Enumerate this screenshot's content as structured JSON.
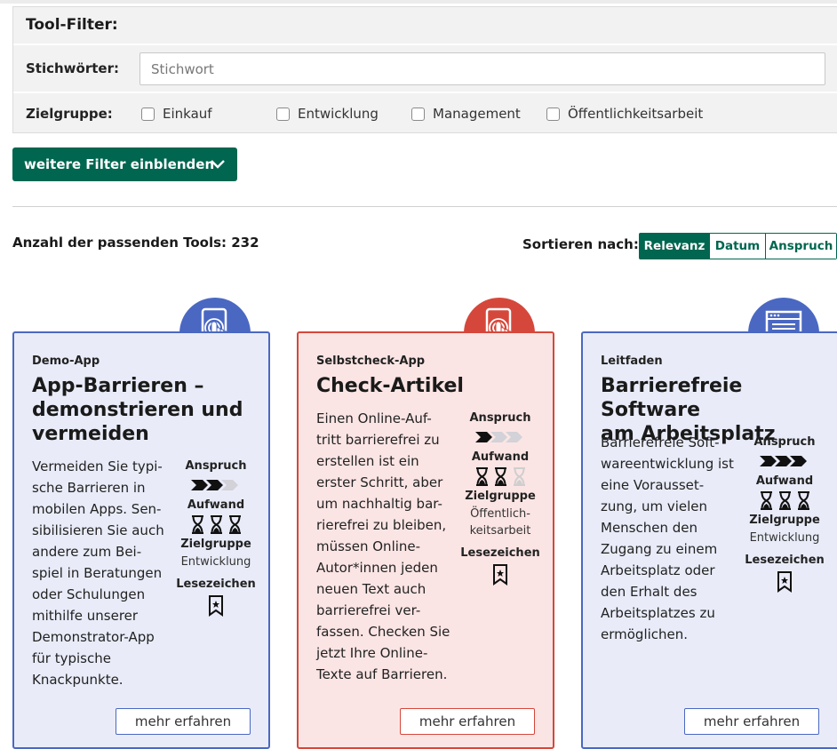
{
  "filter": {
    "title": "Tool-Filter:",
    "keywords_label": "Stichwörter:",
    "keywords_placeholder": "Stichwort",
    "keywords_value": "",
    "audience_label": "Zielgruppe:",
    "audience_options": [
      "Einkauf",
      "Entwicklung",
      "Management",
      "Öffentlichkeitsarbeit"
    ]
  },
  "more_filters_label": "weitere Filter einblenden",
  "results": {
    "count_text": "Anzahl der passenden Tools: 232",
    "sort_label": "Sortieren nach:",
    "sort_options": [
      "Relevanz",
      "Datum",
      "Anspruch"
    ],
    "sort_active": "Relevanz"
  },
  "meta_labels": {
    "anspruch": "Anspruch",
    "aufwand": "Aufwand",
    "zielgruppe": "Zielgruppe",
    "lesezeichen": "Lesezeichen"
  },
  "cards": [
    {
      "type": "Demo-App",
      "title_lines": [
        "App-Barrieren –",
        "demonstrieren und",
        "vermeiden"
      ],
      "desc_lines": [
        "Vermeiden Sie typi-",
        "sche Barrieren in",
        "mobilen Apps. Sen-",
        "sibilisieren Sie auch",
        "andere zum Bei-",
        "spiel in Beratungen",
        "oder Schulungen",
        "mithilfe unserer",
        "Demonstrator-App",
        "für typische",
        "Knackpunkte."
      ],
      "anspruch_level": 2,
      "aufwand_level": 3,
      "zielgruppe_lines": [
        "Entwicklung"
      ],
      "button": "mehr erfahren",
      "icon": "touch-phone-icon",
      "accent": "#4a68c2"
    },
    {
      "type": "Selbstcheck-App",
      "title_lines": [
        "Check-Artikel"
      ],
      "desc_lines": [
        "Einen Online-Auf-",
        "tritt barrierefrei zu",
        "erstellen ist ein",
        "erster Schritt, aber",
        "um nachhaltig bar-",
        "rierefrei zu bleiben,",
        "müssen Online-",
        "Autor*innen jeden",
        "neuen Text auch",
        "barrierefrei ver-",
        "fassen. Checken Sie",
        "jetzt Ihre Online-",
        "Texte auf Barrieren."
      ],
      "anspruch_level": 1,
      "aufwand_level": 2,
      "zielgruppe_lines": [
        "Öffentlich-",
        "keitsarbeit"
      ],
      "button": "mehr erfahren",
      "icon": "touch-phone-icon",
      "accent": "#d6473b"
    },
    {
      "type": "Leitfaden",
      "title_lines": [
        "Barrierefreie Software",
        "am Arbeitsplatz"
      ],
      "desc_lines": [
        "Barrierefreie Soft-",
        "wareentwicklung ist",
        "eine Vorausset-",
        "zung, um vielen",
        "Menschen den",
        "Zugang zu einem",
        "Arbeitsplatz oder",
        "den Erhalt des",
        "Arbeitsplatzes zu",
        "ermöglichen."
      ],
      "anspruch_level": 3,
      "aufwand_level": 3,
      "zielgruppe_lines": [
        "Entwicklung"
      ],
      "button": "mehr erfahren",
      "icon": "document-page-icon",
      "accent": "#4a68c2"
    }
  ],
  "colors": {
    "primary_green": "#00664f",
    "blue_accent": "#4a68c2",
    "red_accent": "#d6473b"
  }
}
